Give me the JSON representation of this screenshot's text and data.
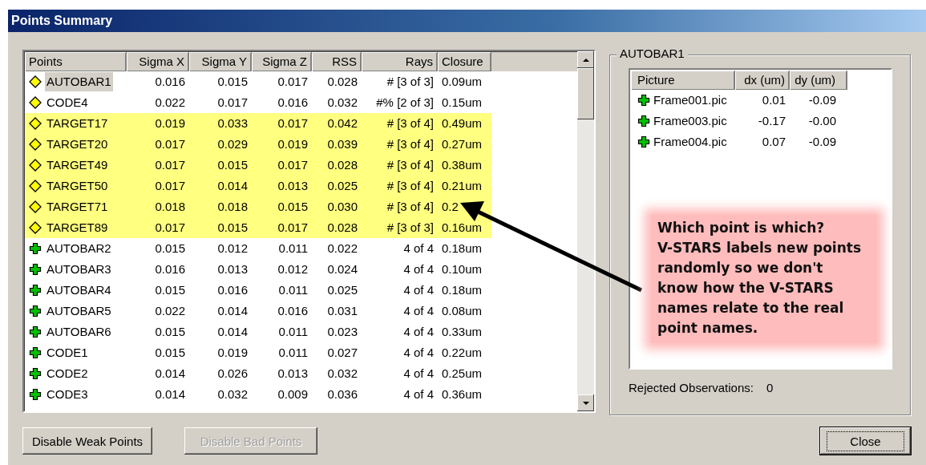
{
  "window": {
    "title": "Points Summary"
  },
  "points_table": {
    "columns": [
      "Points",
      "Sigma X",
      "Sigma Y",
      "Sigma Z",
      "RSS",
      "Rays",
      "Closure"
    ],
    "rows": [
      {
        "kind": "flagged",
        "highlighted": false,
        "selected": true,
        "cells": [
          "AUTOBAR1",
          "0.016",
          "0.015",
          "0.017",
          "0.028",
          "# [3 of 3]",
          "0.09um"
        ]
      },
      {
        "kind": "flagged",
        "highlighted": false,
        "selected": false,
        "cells": [
          "CODE4",
          "0.022",
          "0.017",
          "0.016",
          "0.032",
          "#% [2 of 3]",
          "0.15um"
        ]
      },
      {
        "kind": "flagged",
        "highlighted": true,
        "selected": false,
        "cells": [
          "TARGET17",
          "0.019",
          "0.033",
          "0.017",
          "0.042",
          "# [3 of 4]",
          "0.49um"
        ]
      },
      {
        "kind": "flagged",
        "highlighted": true,
        "selected": false,
        "cells": [
          "TARGET20",
          "0.017",
          "0.029",
          "0.019",
          "0.039",
          "# [3 of 4]",
          "0.27um"
        ]
      },
      {
        "kind": "flagged",
        "highlighted": true,
        "selected": false,
        "cells": [
          "TARGET49",
          "0.017",
          "0.015",
          "0.017",
          "0.028",
          "# [3 of 4]",
          "0.38um"
        ]
      },
      {
        "kind": "flagged",
        "highlighted": true,
        "selected": false,
        "cells": [
          "TARGET50",
          "0.017",
          "0.014",
          "0.013",
          "0.025",
          "# [3 of 4]",
          "0.21um"
        ]
      },
      {
        "kind": "flagged",
        "highlighted": true,
        "selected": false,
        "cells": [
          "TARGET71",
          "0.018",
          "0.018",
          "0.015",
          "0.030",
          "# [3 of 4]",
          "0.2"
        ]
      },
      {
        "kind": "flagged",
        "highlighted": true,
        "selected": false,
        "cells": [
          "TARGET89",
          "0.017",
          "0.015",
          "0.017",
          "0.028",
          "# [3 of 3]",
          "0.16um"
        ]
      },
      {
        "kind": "normal",
        "highlighted": false,
        "selected": false,
        "cells": [
          "AUTOBAR2",
          "0.015",
          "0.012",
          "0.011",
          "0.022",
          "4 of 4",
          "0.18um"
        ]
      },
      {
        "kind": "normal",
        "highlighted": false,
        "selected": false,
        "cells": [
          "AUTOBAR3",
          "0.016",
          "0.013",
          "0.012",
          "0.024",
          "4 of 4",
          "0.10um"
        ]
      },
      {
        "kind": "normal",
        "highlighted": false,
        "selected": false,
        "cells": [
          "AUTOBAR4",
          "0.015",
          "0.016",
          "0.011",
          "0.025",
          "4 of 4",
          "0.18um"
        ]
      },
      {
        "kind": "normal",
        "highlighted": false,
        "selected": false,
        "cells": [
          "AUTOBAR5",
          "0.022",
          "0.014",
          "0.016",
          "0.031",
          "4 of 4",
          "0.08um"
        ]
      },
      {
        "kind": "normal",
        "highlighted": false,
        "selected": false,
        "cells": [
          "AUTOBAR6",
          "0.015",
          "0.014",
          "0.011",
          "0.023",
          "4 of 4",
          "0.33um"
        ]
      },
      {
        "kind": "normal",
        "highlighted": false,
        "selected": false,
        "cells": [
          "CODE1",
          "0.015",
          "0.019",
          "0.011",
          "0.027",
          "4 of 4",
          "0.22um"
        ]
      },
      {
        "kind": "normal",
        "highlighted": false,
        "selected": false,
        "cells": [
          "CODE2",
          "0.014",
          "0.026",
          "0.013",
          "0.032",
          "4 of 4",
          "0.25um"
        ]
      },
      {
        "kind": "normal",
        "highlighted": false,
        "selected": false,
        "cells": [
          "CODE3",
          "0.014",
          "0.032",
          "0.009",
          "0.036",
          "4 of 4",
          "0.36um"
        ]
      }
    ]
  },
  "detail": {
    "group_title": "AUTOBAR1",
    "columns": [
      "Picture",
      "dx (um)",
      "dy (um)"
    ],
    "rows": [
      {
        "cells": [
          "Frame001.pic",
          "0.01",
          "-0.09"
        ]
      },
      {
        "cells": [
          "Frame003.pic",
          "-0.17",
          "-0.00"
        ]
      },
      {
        "cells": [
          "Frame004.pic",
          "0.07",
          "-0.09"
        ]
      }
    ],
    "rejected_label": "Rejected Observations:",
    "rejected_value": "0"
  },
  "callout": {
    "text": "Which point is which?\nV-STARS labels new points\nrandomly so we don't\nknow how the V-STARS\nnames relate to the real\npoint names."
  },
  "buttons": [
    {
      "label": "Disable Weak Points",
      "disabled": false,
      "focused": false
    },
    {
      "label": "Disable Bad Points",
      "disabled": true,
      "focused": false
    },
    {
      "label": "Close",
      "disabled": false,
      "focused": true
    }
  ]
}
